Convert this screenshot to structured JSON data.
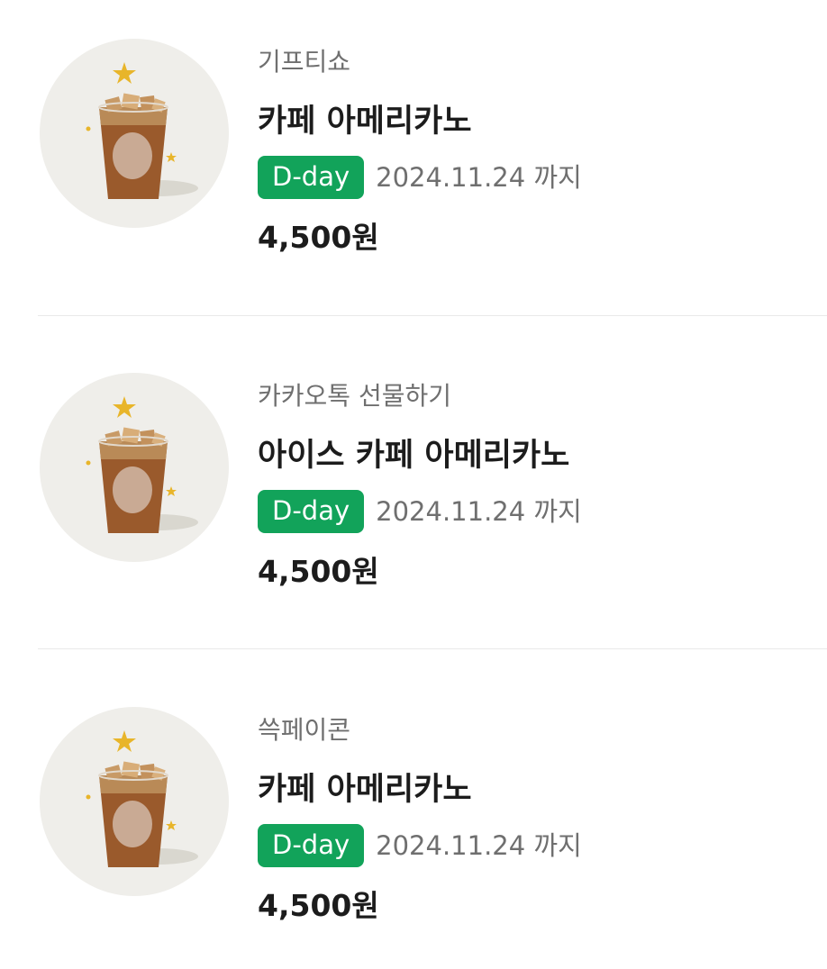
{
  "gifts": [
    {
      "brand": "기프티쇼",
      "product": "카페 아메리카노",
      "badge": "D-day",
      "expiry": "2024.11.24 까지",
      "price": "4,500원",
      "image_icon": "iced-americano-icon"
    },
    {
      "brand": "카카오톡 선물하기",
      "product": "아이스 카페 아메리카노",
      "badge": "D-day",
      "expiry": "2024.11.24 까지",
      "price": "4,500원",
      "image_icon": "iced-americano-icon"
    },
    {
      "brand": "쓱페이콘",
      "product": "카페 아메리카노",
      "badge": "D-day",
      "expiry": "2024.11.24 까지",
      "price": "4,500원",
      "image_icon": "iced-americano-icon"
    }
  ],
  "colors": {
    "badge_bg": "#12a35a",
    "thumb_bg": "#efeeea",
    "star": "#e8b52a",
    "coffee": "#9a5a2c"
  }
}
